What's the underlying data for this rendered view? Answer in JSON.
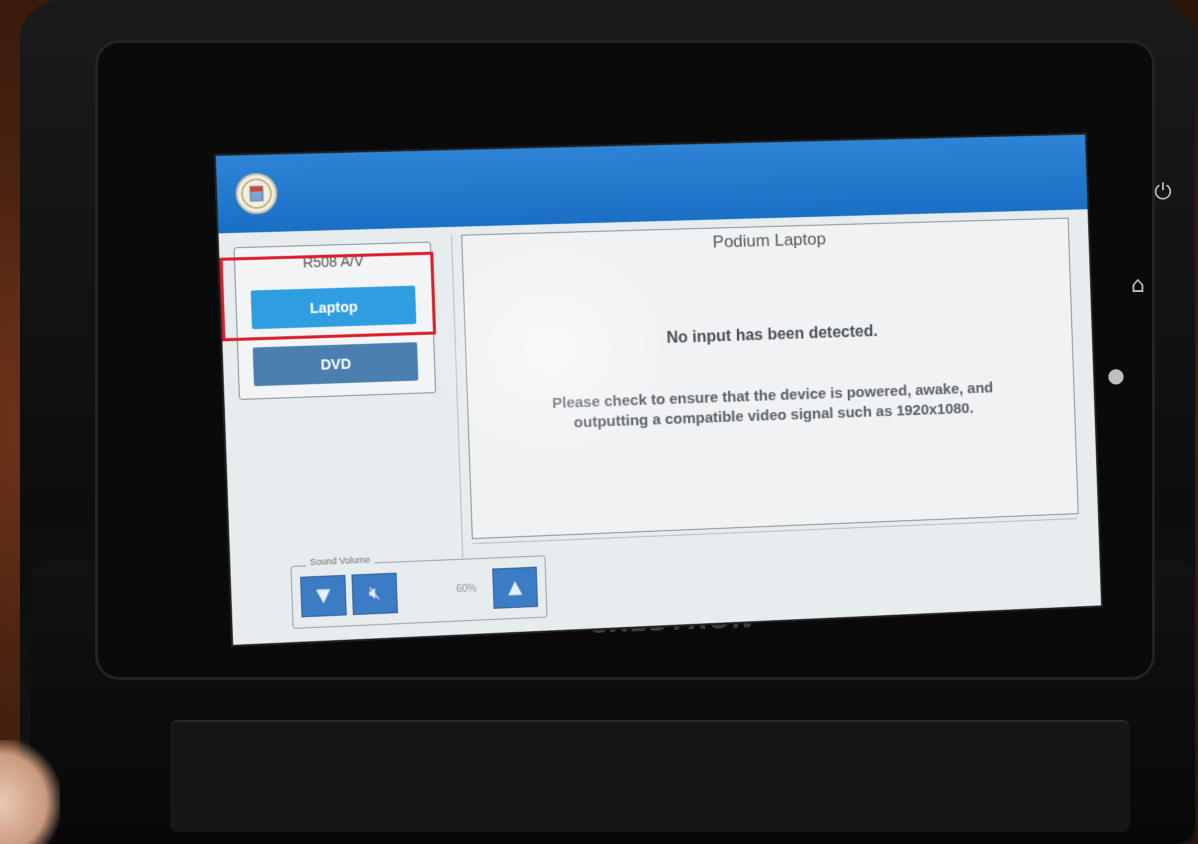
{
  "device": {
    "brand": "CRESTRON",
    "side_buttons": [
      "power-icon",
      "home-icon",
      "light-bulb-icon",
      "up-arrow-icon",
      "down-arrow-icon"
    ]
  },
  "screen": {
    "header_color": "#1f77cc",
    "logo": "seal-logo",
    "source_group": {
      "label": "R508 A/V",
      "buttons": [
        {
          "label": "Laptop",
          "state": "active",
          "color": "#2f9ee0"
        },
        {
          "label": "DVD",
          "state": "idle",
          "color": "#4a7faf"
        }
      ]
    },
    "content": {
      "title": "Podium Laptop",
      "message": "No input has been detected.",
      "detail": "Please check to ensure that the device is powered, awake, and outputting a compatible video signal such as 1920x1080."
    },
    "volume": {
      "label": "Sound Volume",
      "level": "60%",
      "down_icon": "chevron-down-icon",
      "mute_icon": "mute-icon",
      "up_icon": "chevron-up-icon"
    },
    "highlight_color": "#d8202a"
  }
}
